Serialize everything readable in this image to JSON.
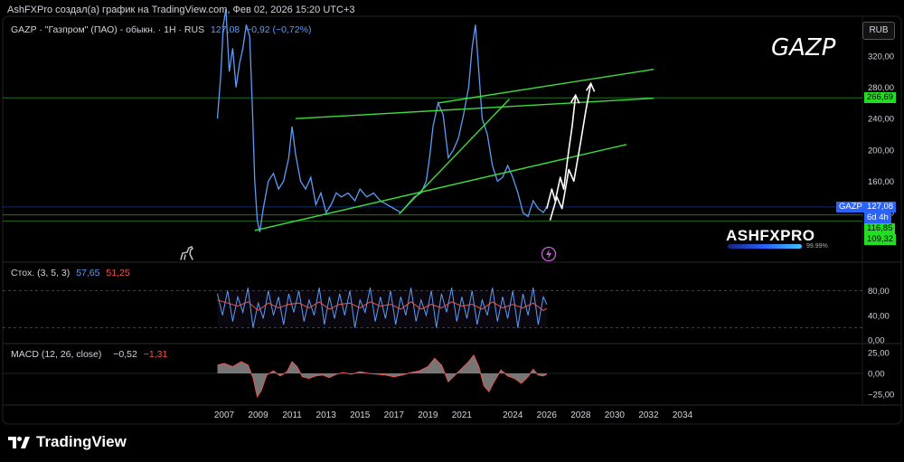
{
  "attribution": "AshFXPro создал(а) график на TradingView.com, Фев 02, 2026 15:20 UTC+3",
  "symbol_legend": {
    "name": "GAZP · \"Газпром\" (ПАО) - обыкн. · 1H · RUS",
    "price": "127,08",
    "change": "−0,92 (−0,72%)"
  },
  "watermark": "GAZP",
  "currency_button": "RUB",
  "brand": {
    "name": "ASHFXPRO",
    "percent": "99.99%"
  },
  "price_tags": {
    "symbol": "GAZP",
    "last": "127,08",
    "countdown": "6d 4h",
    "level_upper": "266,69",
    "level_mid": "116,85",
    "level_low": "109,32"
  },
  "stoch_legend": {
    "label": "Стох. (3, 5, 3)",
    "k": "57,65",
    "d": "51,25"
  },
  "macd_legend": {
    "label": "MACD (12, 26, close)",
    "macd": "−0,52",
    "signal": "−1,31"
  },
  "footer": "TradingView",
  "icons": [
    "dino-icon",
    "lightning-icon",
    "tradingview-logo-icon"
  ],
  "colors": {
    "price": "#5b9cf6",
    "trendline": "#3ddc3d",
    "projection": "#ffffff",
    "k": "#5b9cf6",
    "d": "#ef5350",
    "green_tag": "#22dd22",
    "blue_tag": "#2962ff"
  },
  "chart_data": [
    {
      "type": "line",
      "title": "",
      "series": [
        {
          "values": [
            [
              2006.6,
              240
            ],
            [
              2006.8,
              295
            ],
            [
              2006.95,
              360
            ],
            [
              2007.1,
              380
            ],
            [
              2007.3,
              300
            ],
            [
              2007.5,
              330
            ],
            [
              2007.7,
              280
            ],
            [
              2007.9,
              310
            ],
            [
              2008.1,
              330
            ],
            [
              2008.3,
              360
            ],
            [
              2008.5,
              345
            ],
            [
              2008.65,
              260
            ],
            [
              2008.8,
              160
            ],
            [
              2008.95,
              110
            ],
            [
              2009.1,
              95
            ],
            [
              2009.3,
              125
            ],
            [
              2009.6,
              160
            ],
            [
              2009.9,
              170
            ],
            [
              2010.2,
              150
            ],
            [
              2010.5,
              160
            ],
            [
              2010.8,
              190
            ],
            [
              2011.0,
              230
            ],
            [
              2011.2,
              195
            ],
            [
              2011.5,
              160
            ],
            [
              2011.8,
              150
            ],
            [
              2012.1,
              165
            ],
            [
              2012.4,
              130
            ],
            [
              2012.7,
              145
            ],
            [
              2013.0,
              120
            ],
            [
              2013.3,
              130
            ],
            [
              2013.6,
              145
            ],
            [
              2013.9,
              140
            ],
            [
              2014.3,
              145
            ],
            [
              2014.7,
              135
            ],
            [
              2015.0,
              150
            ],
            [
              2015.4,
              140
            ],
            [
              2015.8,
              145
            ],
            [
              2016.2,
              135
            ],
            [
              2016.6,
              130
            ],
            [
              2017.0,
              125
            ],
            [
              2017.4,
              120
            ],
            [
              2017.8,
              130
            ],
            [
              2018.2,
              140
            ],
            [
              2018.6,
              145
            ],
            [
              2018.9,
              160
            ],
            [
              2019.1,
              190
            ],
            [
              2019.3,
              230
            ],
            [
              2019.6,
              260
            ],
            [
              2019.9,
              245
            ],
            [
              2020.2,
              190
            ],
            [
              2020.5,
              200
            ],
            [
              2020.8,
              215
            ],
            [
              2021.1,
              245
            ],
            [
              2021.4,
              280
            ],
            [
              2021.6,
              330
            ],
            [
              2021.8,
              360
            ],
            [
              2022.0,
              300
            ],
            [
              2022.2,
              240
            ],
            [
              2022.5,
              220
            ],
            [
              2022.8,
              180
            ],
            [
              2023.1,
              160
            ],
            [
              2023.4,
              165
            ],
            [
              2023.7,
              180
            ],
            [
              2024.0,
              165
            ],
            [
              2024.3,
              145
            ],
            [
              2024.6,
              120
            ],
            [
              2024.9,
              115
            ],
            [
              2025.2,
              135
            ],
            [
              2025.5,
              125
            ],
            [
              2025.8,
              120
            ],
            [
              2026.0,
              127
            ]
          ]
        }
      ],
      "xlabel": "",
      "ylabel": "",
      "x_ticks": [
        "2007",
        "2009",
        "2011",
        "2013",
        "2015",
        "2017",
        "2019",
        "2021",
        "2024",
        "2026",
        "2028",
        "2030",
        "2032",
        "2034"
      ],
      "y_ticks": [
        "320,00",
        "280,00",
        "240,00",
        "200,00",
        "160,00",
        "120,00"
      ],
      "ylim": [
        94,
        375
      ],
      "xlim": [
        2006,
        2035
      ],
      "grid": false
    },
    {
      "type": "line",
      "title": "",
      "series": [
        {
          "name": "%K",
          "values": [
            [
              2006.6,
              75
            ],
            [
              2006.9,
              40
            ],
            [
              2007.2,
              80
            ],
            [
              2007.5,
              30
            ],
            [
              2007.8,
              70
            ],
            [
              2008.1,
              45
            ],
            [
              2008.4,
              85
            ],
            [
              2008.7,
              20
            ],
            [
              2009.0,
              60
            ],
            [
              2009.3,
              35
            ],
            [
              2009.6,
              80
            ],
            [
              2009.9,
              40
            ],
            [
              2010.2,
              70
            ],
            [
              2010.5,
              25
            ],
            [
              2010.8,
              75
            ],
            [
              2011.1,
              45
            ],
            [
              2011.4,
              80
            ],
            [
              2011.7,
              30
            ],
            [
              2012.0,
              65
            ],
            [
              2012.3,
              40
            ],
            [
              2012.6,
              85
            ],
            [
              2012.9,
              25
            ],
            [
              2013.2,
              70
            ],
            [
              2013.5,
              35
            ],
            [
              2013.8,
              75
            ],
            [
              2014.1,
              40
            ],
            [
              2014.4,
              80
            ],
            [
              2014.7,
              20
            ],
            [
              2015.0,
              65
            ],
            [
              2015.3,
              45
            ],
            [
              2015.6,
              85
            ],
            [
              2015.9,
              30
            ],
            [
              2016.2,
              70
            ],
            [
              2016.5,
              35
            ],
            [
              2016.8,
              80
            ],
            [
              2017.1,
              25
            ],
            [
              2017.4,
              70
            ],
            [
              2017.7,
              40
            ],
            [
              2018.0,
              85
            ],
            [
              2018.3,
              30
            ],
            [
              2018.6,
              65
            ],
            [
              2018.9,
              40
            ],
            [
              2019.2,
              80
            ],
            [
              2019.5,
              20
            ],
            [
              2019.8,
              75
            ],
            [
              2020.1,
              45
            ],
            [
              2020.4,
              85
            ],
            [
              2020.7,
              30
            ],
            [
              2021.0,
              70
            ],
            [
              2021.3,
              35
            ],
            [
              2021.6,
              80
            ],
            [
              2021.9,
              25
            ],
            [
              2022.2,
              65
            ],
            [
              2022.5,
              40
            ],
            [
              2022.8,
              85
            ],
            [
              2023.1,
              30
            ],
            [
              2023.4,
              70
            ],
            [
              2023.7,
              35
            ],
            [
              2024.0,
              80
            ],
            [
              2024.3,
              20
            ],
            [
              2024.6,
              75
            ],
            [
              2024.9,
              40
            ],
            [
              2025.2,
              85
            ],
            [
              2025.5,
              25
            ],
            [
              2025.8,
              70
            ],
            [
              2026.0,
              58
            ]
          ]
        },
        {
          "name": "%D",
          "values": [
            [
              2006.6,
              65
            ],
            [
              2007.2,
              60
            ],
            [
              2007.8,
              55
            ],
            [
              2008.4,
              62
            ],
            [
              2009.0,
              48
            ],
            [
              2009.6,
              60
            ],
            [
              2010.2,
              52
            ],
            [
              2010.8,
              58
            ],
            [
              2011.4,
              60
            ],
            [
              2012.0,
              52
            ],
            [
              2012.6,
              62
            ],
            [
              2013.2,
              50
            ],
            [
              2013.8,
              58
            ],
            [
              2014.4,
              60
            ],
            [
              2015.0,
              52
            ],
            [
              2015.6,
              62
            ],
            [
              2016.2,
              55
            ],
            [
              2016.8,
              58
            ],
            [
              2017.4,
              50
            ],
            [
              2018.0,
              62
            ],
            [
              2018.6,
              50
            ],
            [
              2019.2,
              58
            ],
            [
              2019.8,
              52
            ],
            [
              2020.4,
              62
            ],
            [
              2021.0,
              55
            ],
            [
              2021.6,
              58
            ],
            [
              2022.2,
              50
            ],
            [
              2022.8,
              62
            ],
            [
              2023.4,
              52
            ],
            [
              2024.0,
              58
            ],
            [
              2024.6,
              52
            ],
            [
              2025.2,
              60
            ],
            [
              2025.8,
              48
            ],
            [
              2026.0,
              51
            ]
          ]
        }
      ],
      "y_ticks": [
        "80,00",
        "40,00",
        "0,00"
      ],
      "ylim": [
        0,
        100
      ]
    },
    {
      "type": "area",
      "title": "",
      "series": [
        {
          "values": [
            [
              2006.6,
              10
            ],
            [
              2007.0,
              12
            ],
            [
              2007.5,
              8
            ],
            [
              2008.0,
              14
            ],
            [
              2008.4,
              10
            ],
            [
              2008.7,
              -5
            ],
            [
              2008.95,
              -28
            ],
            [
              2009.2,
              -20
            ],
            [
              2009.5,
              -2
            ],
            [
              2009.9,
              3
            ],
            [
              2010.3,
              -3
            ],
            [
              2010.7,
              2
            ],
            [
              2011.0,
              14
            ],
            [
              2011.3,
              8
            ],
            [
              2011.6,
              -4
            ],
            [
              2012.0,
              -6
            ],
            [
              2012.4,
              -3
            ],
            [
              2012.8,
              -2
            ],
            [
              2013.2,
              -5
            ],
            [
              2013.6,
              -1
            ],
            [
              2014.0,
              1
            ],
            [
              2014.5,
              -1
            ],
            [
              2015.0,
              2
            ],
            [
              2015.5,
              0
            ],
            [
              2016.0,
              -1
            ],
            [
              2016.5,
              -2
            ],
            [
              2017.0,
              -4
            ],
            [
              2017.5,
              -2
            ],
            [
              2018.0,
              1
            ],
            [
              2018.5,
              3
            ],
            [
              2019.0,
              8
            ],
            [
              2019.4,
              18
            ],
            [
              2019.8,
              10
            ],
            [
              2020.2,
              -10
            ],
            [
              2020.6,
              -2
            ],
            [
              2021.0,
              6
            ],
            [
              2021.4,
              14
            ],
            [
              2021.7,
              22
            ],
            [
              2022.0,
              8
            ],
            [
              2022.3,
              -15
            ],
            [
              2022.6,
              -22
            ],
            [
              2022.9,
              -10
            ],
            [
              2023.3,
              4
            ],
            [
              2023.7,
              -3
            ],
            [
              2024.1,
              -6
            ],
            [
              2024.5,
              -12
            ],
            [
              2024.9,
              -4
            ],
            [
              2025.2,
              5
            ],
            [
              2025.5,
              -2
            ],
            [
              2025.8,
              -3
            ],
            [
              2026.0,
              -1
            ]
          ]
        }
      ],
      "y_ticks": [
        "25,00",
        "0,00",
        "−25,00"
      ],
      "ylim": [
        -34,
        33
      ]
    }
  ]
}
